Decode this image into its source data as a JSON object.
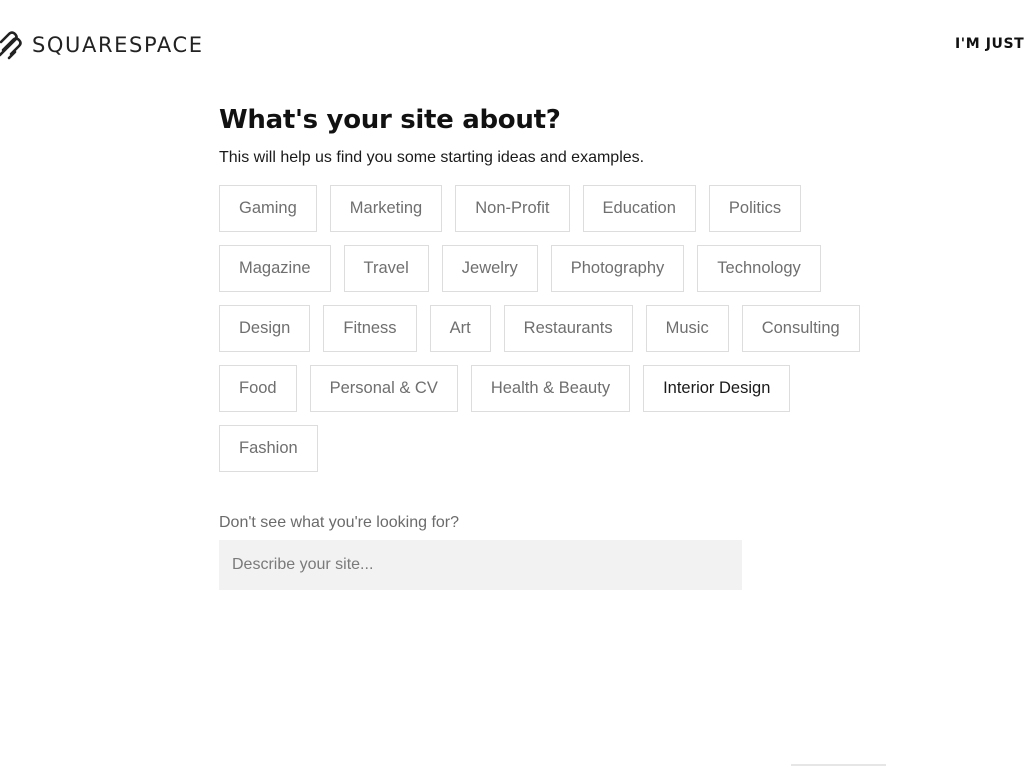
{
  "header": {
    "logo_text": "SQUARESPACE",
    "top_right_link": "I'M JUST"
  },
  "main": {
    "title": "What's your site about?",
    "subtitle": "This will help us find you some starting ideas and examples.",
    "categories": [
      "Gaming",
      "Marketing",
      "Non-Profit",
      "Education",
      "Politics",
      "Magazine",
      "Travel",
      "Jewelry",
      "Photography",
      "Technology",
      "Design",
      "Fitness",
      "Art",
      "Restaurants",
      "Music",
      "Consulting",
      "Food",
      "Personal & CV",
      "Health & Beauty",
      "Interior Design",
      "Fashion"
    ],
    "highlighted_category": "Interior Design",
    "other_label": "Don't see what you're looking for?",
    "input_placeholder": "Describe your site...",
    "input_value": ""
  },
  "colors": {
    "tag_border": "#dddddd",
    "tag_text": "#6f6f6f",
    "tag_text_highlight": "#1a1a1a",
    "input_background": "#f2f2f2"
  },
  "icons": {
    "logo": "squarespace-logo-icon"
  }
}
